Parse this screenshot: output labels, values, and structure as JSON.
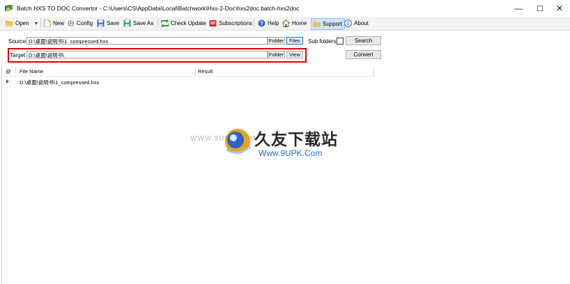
{
  "window": {
    "title": "Batch HXS TO DOC Convertor - C:\\Users\\CS\\AppData\\Local\\Batchwork\\Hxs-2-Doc\\hxs2doc.batch-hxs2doc",
    "minimize": "—",
    "maximize": "☐",
    "close": "✕"
  },
  "toolbar": {
    "open": "Open",
    "dropdown": "▾",
    "new": "New",
    "config": "Config",
    "save": "Save",
    "save_as": "Save As",
    "check_update": "Check Update",
    "subscriptions": "Subscriptions",
    "help": "Help",
    "home": "Home",
    "support": "Support",
    "about": "About"
  },
  "form": {
    "source_label": "Source",
    "source_value": "D:\\桌面\\说明书\\1_compressed.hxs",
    "target_label": "Target",
    "target_value": "D:\\桌面\\说明书\\",
    "folder_label": "Folder",
    "files_label": "Files",
    "view_label": "View",
    "subfolders_label": "Sub folders",
    "search_label": "Search",
    "convert_label": "Convert"
  },
  "list": {
    "columns": [
      "@",
      "File Name",
      "Result"
    ],
    "rows": [
      {
        "file": "D:\\桌面\\说明书\\1_compressed.hxs",
        "result": ""
      }
    ]
  },
  "watermark": {
    "small": "WWW.9UPK.COM",
    "big": "久友下载站",
    "url": "Www.9UPK.Com"
  },
  "colors": {
    "highlight_border": "#e00000",
    "support_bg": "#cfe3fb",
    "accent": "#0078d7"
  }
}
